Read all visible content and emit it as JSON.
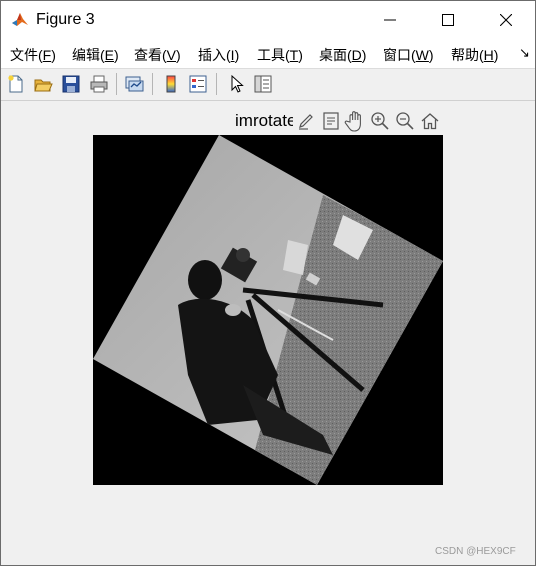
{
  "window": {
    "title": "Figure 3",
    "app_icon": "matlab-icon",
    "controls": [
      "minimize-icon",
      "maximize-icon",
      "close-icon"
    ]
  },
  "menubar": {
    "items": [
      {
        "text": "文件(",
        "key": "F",
        "close": ")"
      },
      {
        "text": "编辑(",
        "key": "E",
        "close": ")"
      },
      {
        "text": "查看(",
        "key": "V",
        "close": ")"
      },
      {
        "text": "插入(",
        "key": "I",
        "close": ")"
      },
      {
        "text": "工具(",
        "key": "T",
        "close": ")"
      },
      {
        "text": "桌面(",
        "key": "D",
        "close": ")"
      },
      {
        "text": "窗口(",
        "key": "W",
        "close": ")"
      },
      {
        "text": "帮助(",
        "key": "H",
        "close": ")"
      }
    ],
    "overflow_icon": "↘"
  },
  "toolbar": {
    "icons": [
      "new-figure-icon",
      "open-file-icon",
      "save-icon",
      "print-icon",
      "link-plot-icon",
      "colorbar-icon",
      "legend-icon",
      "pointer-icon",
      "property-inspector-icon"
    ]
  },
  "axes": {
    "title": "imrotate",
    "toolbar_icons": [
      "brush-icon",
      "data-tips-icon",
      "pan-icon",
      "zoom-in-icon",
      "zoom-out-icon",
      "home-icon"
    ],
    "image_description_icon": "rotated-cameraman-image"
  },
  "watermark": "CSDN @HEX9CF"
}
